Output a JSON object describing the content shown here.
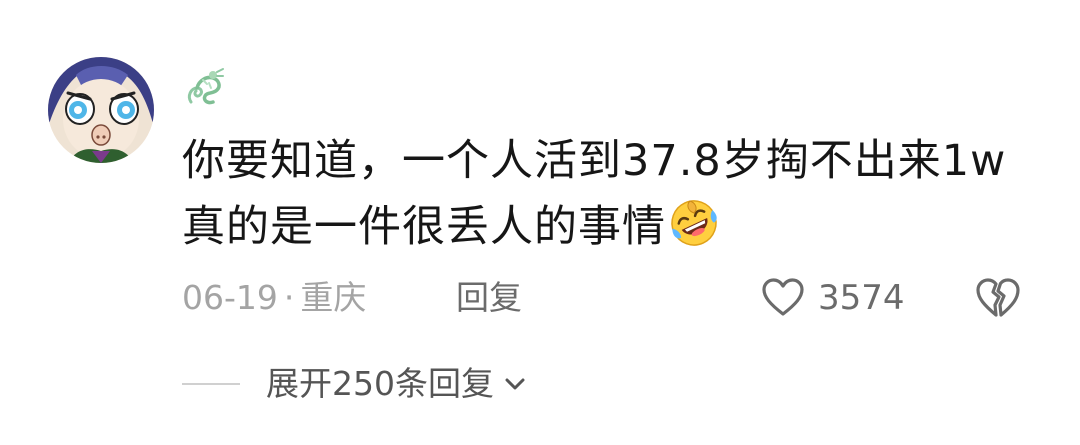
{
  "comment": {
    "avatar_icon": "cartoon-face-avatar",
    "badge_icon": "green-dragon-icon",
    "text_line1": "你要知道，一个人活到37.8岁掏不出来1w",
    "text_line2": "真的是一件很丢人的事情",
    "emoji_icon": "rolling-laughing-emoji",
    "date": "06-19",
    "separator": "·",
    "location": "重庆",
    "reply_label": "回复",
    "like_icon": "heart-outline-icon",
    "like_count": "3574",
    "dislike_icon": "broken-heart-outline-icon"
  },
  "replies": {
    "expand_label": "展开250条回复",
    "expand_icon": "chevron-down-icon"
  },
  "colors": {
    "text": "#161616",
    "meta": "#a4a4a4",
    "action": "#6b6b6b",
    "icon_stroke": "#6b6b6b"
  }
}
